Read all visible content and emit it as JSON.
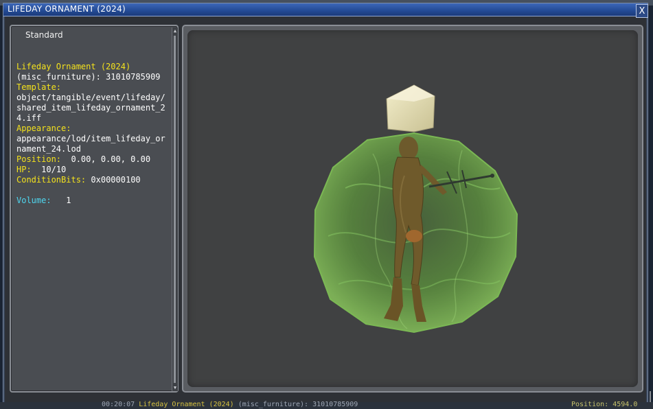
{
  "window": {
    "title": "LIFEDAY ORNAMENT (2024)",
    "close_label": "X"
  },
  "panel": {
    "dropdown_value": "Standard",
    "name": "Lifeday Ornament (2024)",
    "id_line": "(misc_furniture): 31010785909",
    "template_label": "Template:",
    "template_value": "object/tangible/event/lifeday/shared_item_lifeday_ornament_24.iff",
    "appearance_label": "Appearance:",
    "appearance_value": "appearance/lod/item_lifeday_ornament_24.lod",
    "position_label": "Position:",
    "position_value": "0.00, 0.00, 0.00",
    "hp_label": "HP:",
    "hp_value": "10/10",
    "condition_label": "ConditionBits:",
    "condition_value": "0x00000100",
    "volume_label": "Volume:",
    "volume_value": "1"
  },
  "background": {
    "chat_time": "00:20:07",
    "chat_item": "Lifeday Ornament (2024)",
    "chat_rest": "(misc_furniture): 31010785909",
    "position_label": "Position:",
    "position_value": "4594.0"
  },
  "colors": {
    "label_yellow": "#f4e21c",
    "label_cyan": "#4fd7f0",
    "title_blue": "#234a94",
    "ornament_green": "#5f9a3c"
  }
}
